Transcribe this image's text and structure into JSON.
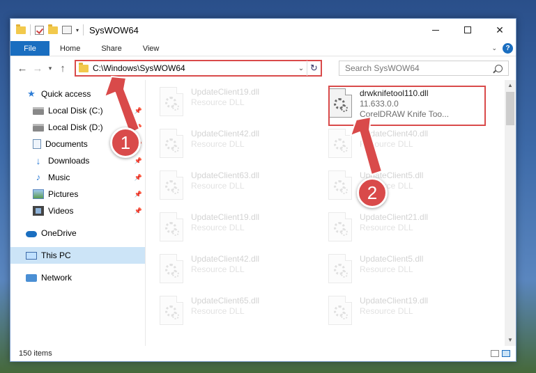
{
  "titlebar": {
    "title": "SysWOW64"
  },
  "ribbon": {
    "tabs": [
      "File",
      "Home",
      "Share",
      "View"
    ],
    "help_label": "?"
  },
  "address": {
    "path": "C:\\Windows\\SysWOW64"
  },
  "search": {
    "placeholder": "Search SysWOW64"
  },
  "sidebar": {
    "quick_access": "Quick access",
    "items": [
      {
        "label": "Local Disk (C:)",
        "icon": "drive-icon",
        "pinned": true
      },
      {
        "label": "Local Disk (D:)",
        "icon": "drive-icon",
        "pinned": true
      },
      {
        "label": "Documents",
        "icon": "documents-icon",
        "pinned": true
      },
      {
        "label": "Downloads",
        "icon": "downloads-icon",
        "pinned": true
      },
      {
        "label": "Music",
        "icon": "music-icon",
        "pinned": true
      },
      {
        "label": "Pictures",
        "icon": "pictures-icon",
        "pinned": true
      },
      {
        "label": "Videos",
        "icon": "videos-icon",
        "pinned": true
      }
    ],
    "onedrive": "OneDrive",
    "this_pc": "This PC",
    "network": "Network"
  },
  "files": {
    "left_column": [
      {
        "name": "UpdateClient19.dll",
        "type": "Resource DLL"
      },
      {
        "name": "UpdateClient42.dll",
        "type": "Resource DLL"
      },
      {
        "name": "UpdateClient63.dll",
        "type": "Resource DLL"
      },
      {
        "name": "UpdateClient19.dll",
        "type": "Resource DLL"
      },
      {
        "name": "UpdateClient42.dll",
        "type": "Resource DLL"
      },
      {
        "name": "UpdateClient65.dll",
        "type": "Resource DLL"
      }
    ],
    "right_column": [
      {
        "name": "drwknifetool110.dll",
        "version": "11.633.0.0",
        "type": "CorelDRAW Knife Too..."
      },
      {
        "name": "UpdateClient40.dll",
        "type": "Resource DLL"
      },
      {
        "name": "UpdateClient5.dll",
        "type": "Resource DLL"
      },
      {
        "name": "UpdateClient21.dll",
        "type": "Resource DLL"
      },
      {
        "name": "UpdateClient5.dll",
        "type": "Resource DLL"
      },
      {
        "name": "UpdateClient19.dll",
        "type": "Resource DLL"
      }
    ]
  },
  "status": {
    "item_count": "150 items"
  },
  "annotations": {
    "step1": "1",
    "step2": "2",
    "color": "#d94a4a"
  }
}
